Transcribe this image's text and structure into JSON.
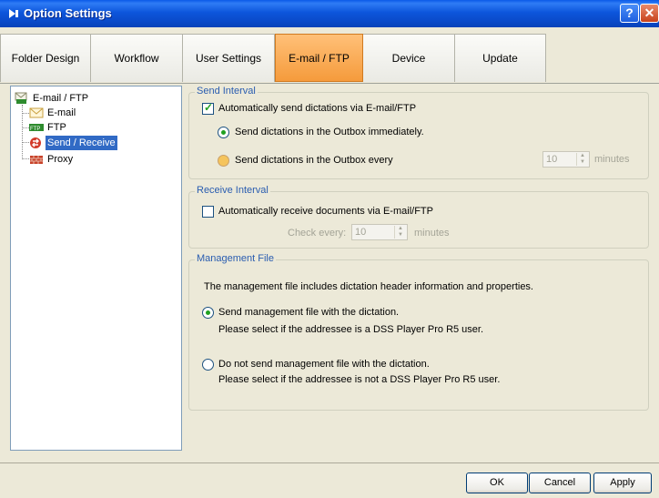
{
  "window": {
    "title": "Option Settings",
    "help_label": "?",
    "close_label": "✕"
  },
  "tabs": [
    {
      "label": "Folder Design"
    },
    {
      "label": "Workflow"
    },
    {
      "label": "User Settings"
    },
    {
      "label": "E-mail / FTP"
    },
    {
      "label": "Device"
    },
    {
      "label": "Update"
    }
  ],
  "tree": {
    "root": "E-mail / FTP",
    "items": [
      {
        "label": "E-mail"
      },
      {
        "label": "FTP"
      },
      {
        "label": "Send / Receive"
      },
      {
        "label": "Proxy"
      }
    ]
  },
  "send_interval": {
    "title": "Send Interval",
    "auto_send_label": "Automatically send dictations via E-mail/FTP",
    "immediate_label": "Send dictations in the Outbox immediately.",
    "every_label": "Send dictations in the Outbox every",
    "every_value": "10",
    "minutes_label": "minutes"
  },
  "receive_interval": {
    "title": "Receive Interval",
    "auto_receive_label": "Automatically receive documents via E-mail/FTP",
    "check_every_label": "Check every:",
    "check_every_value": "10",
    "minutes_label": "minutes"
  },
  "management_file": {
    "title": "Management File",
    "description": "The management file includes dictation header information and properties.",
    "send_label": "Send management file with the dictation.",
    "send_note": "Please select if the addressee is a DSS Player Pro R5 user.",
    "nosend_label": "Do not send management file with the dictation.",
    "nosend_note": "Please select if the addressee is not a DSS Player Pro R5 user."
  },
  "buttons": {
    "ok": "OK",
    "cancel": "Cancel",
    "apply": "Apply"
  }
}
